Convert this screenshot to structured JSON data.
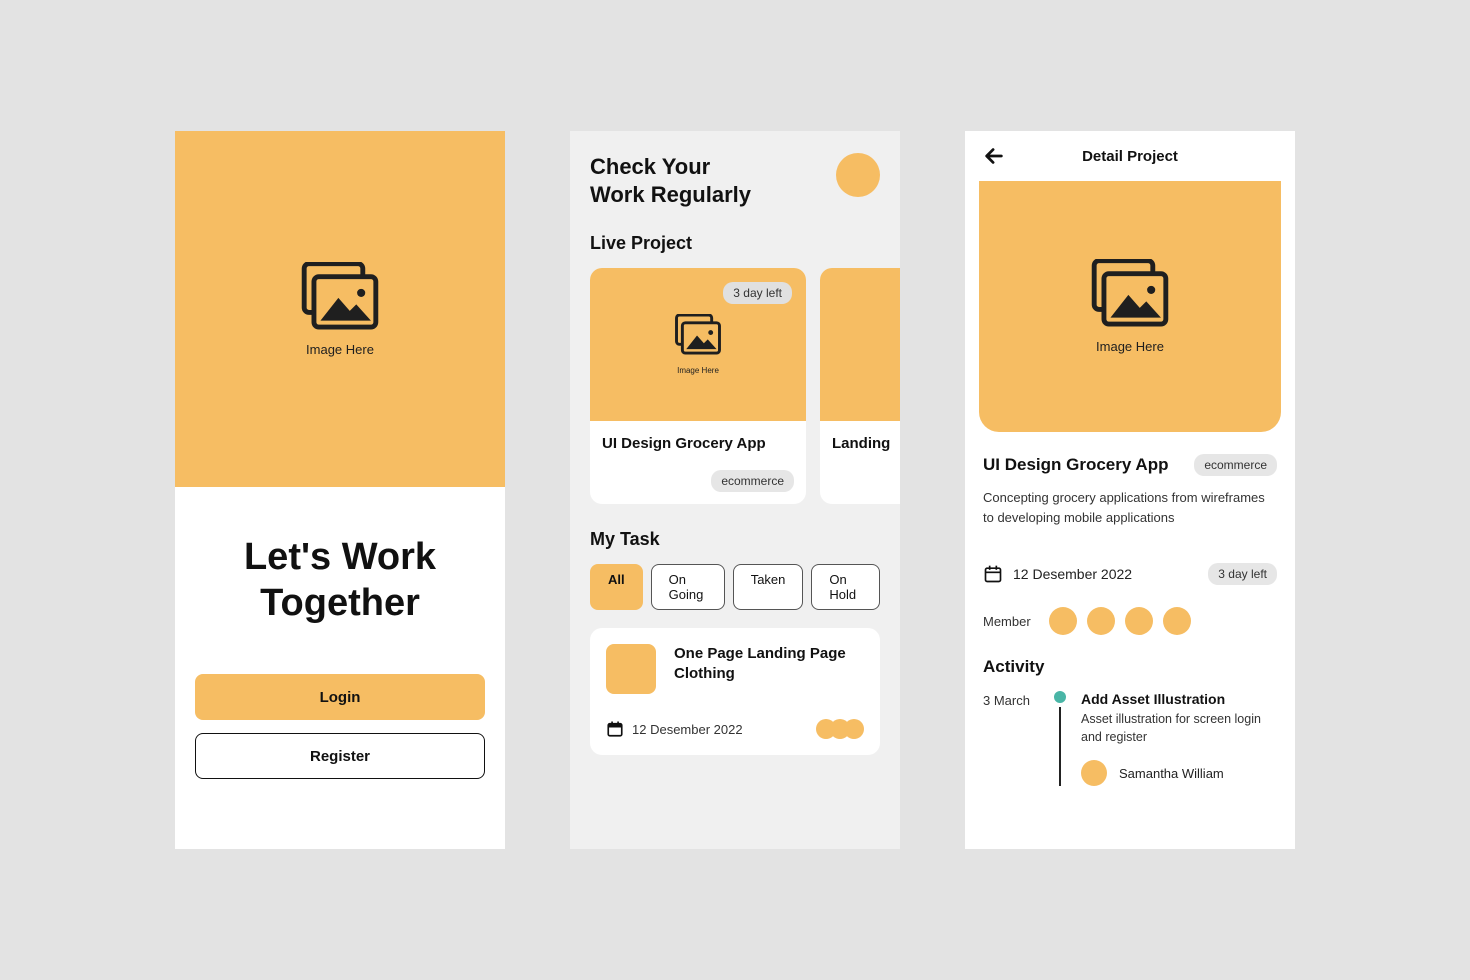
{
  "placeholder_label": "Image Here",
  "onboarding": {
    "title": "Let's Work Together",
    "login_label": "Login",
    "register_label": "Register"
  },
  "dashboard": {
    "heading_l1": "Check Your",
    "heading_l2": "Work Regularly",
    "live_section": "Live Project",
    "my_task_section": "My Task",
    "tabs": {
      "all": "All",
      "ongoing": "On Going",
      "taken": "Taken",
      "onhold": "On Hold"
    },
    "projects": [
      {
        "title": "UI Design Grocery App",
        "tag": "ecommerce",
        "time_left": "3 day left"
      },
      {
        "title": "Landing"
      }
    ],
    "task": {
      "title": "One Page Landing Page Clothing",
      "date": "12 Desember 2022"
    }
  },
  "detail": {
    "topbar_title": "Detail Project",
    "title": "UI Design Grocery App",
    "tag": "ecommerce",
    "description": "Concepting grocery applications from wireframes to developing mobile applications",
    "date": "12 Desember 2022",
    "time_left": "3 day left",
    "member_label": "Member",
    "activity_heading": "Activity",
    "activity_date": "3 March",
    "activity": {
      "title": "Add Asset Illustration",
      "desc": "Asset illustration for screen login and register",
      "user": "Samantha William"
    }
  }
}
